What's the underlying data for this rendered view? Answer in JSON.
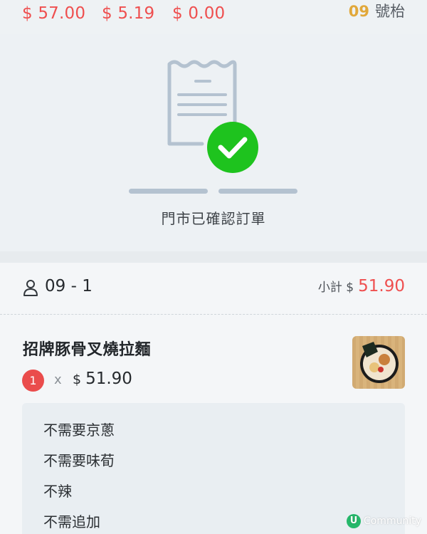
{
  "totals": {
    "values": [
      "$ 57.00",
      "$ 5.19",
      "$ 0.00"
    ]
  },
  "table": {
    "number": "09",
    "label": "號枱"
  },
  "confirmation": {
    "text": "門市已確認訂單",
    "icon": "receipt-check-icon",
    "accent_color": "#1ec31e"
  },
  "order": {
    "table_code": "09 - 1",
    "subtotal_label": "小計 $",
    "subtotal_value": "51.90"
  },
  "item": {
    "name": "招牌豚骨叉燒拉麵",
    "quantity": "1",
    "times": "x",
    "price_symbol": "$",
    "price": "51.90",
    "options": [
      "不需要京蔥",
      "不需要味荀",
      "不辣",
      "不需追加"
    ]
  },
  "watermark": {
    "logo": "U",
    "text": "Community"
  },
  "colors": {
    "price_red": "#ef4f4f",
    "table_number": "#e1a83a",
    "badge_red": "#ea4c4c"
  }
}
